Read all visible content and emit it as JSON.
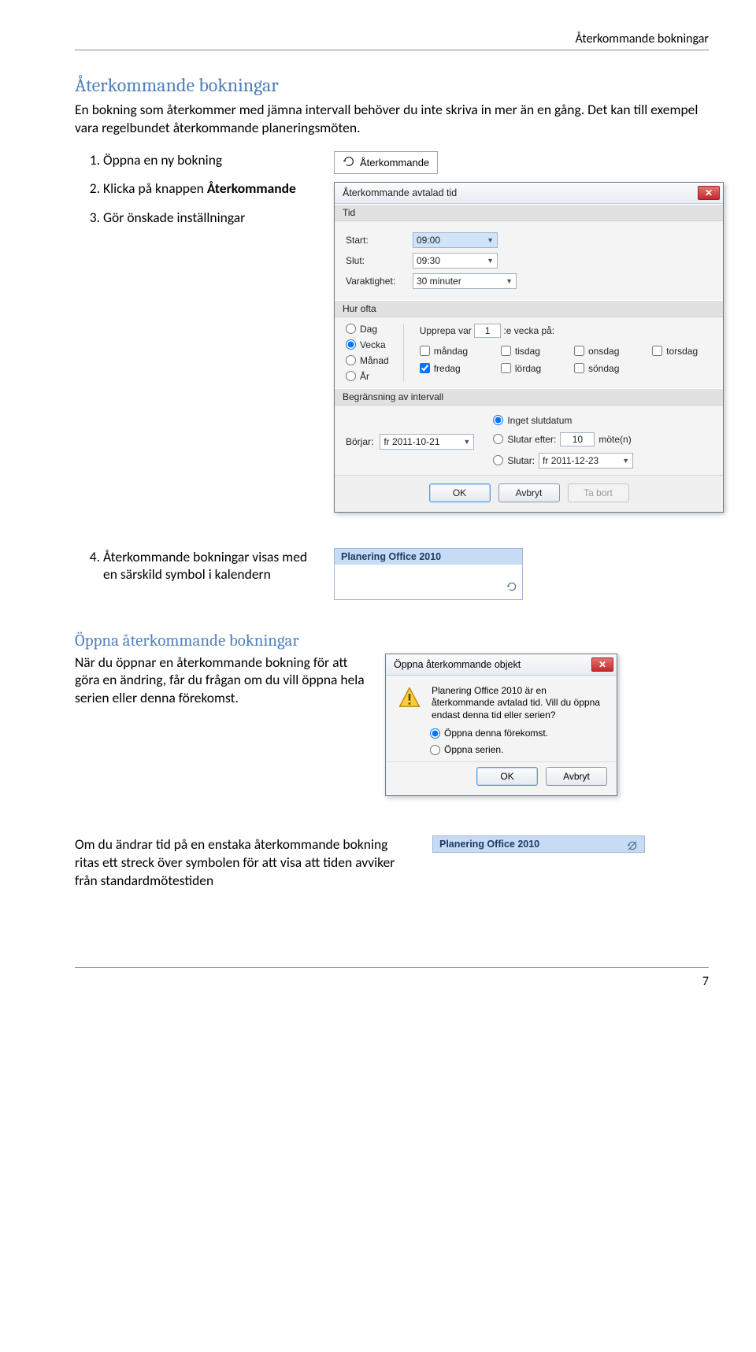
{
  "header": {
    "text": "Återkommande bokningar"
  },
  "title": "Återkommande bokningar",
  "intro": "En bokning som återkommer med jämna intervall behöver du inte skriva in mer än en gång. Det kan till exempel vara regelbundet återkommande planeringsmöten.",
  "steps": {
    "s1": "Öppna en ny bokning",
    "s2a": "Klicka på knappen ",
    "s2b": "Återkommande",
    "s3": "Gör önskade inställningar",
    "s4": "Återkommande bokningar visas med en särskild symbol i kalendern"
  },
  "recurButton": {
    "label": "Återkommande"
  },
  "dialog": {
    "title": "Återkommande avtalad tid",
    "groupTime": "Tid",
    "start": "Start:",
    "startVal": "09:00",
    "end": "Slut:",
    "endVal": "09:30",
    "duration": "Varaktighet:",
    "durationVal": "30 minuter",
    "groupPattern": "Hur ofta",
    "optDay": "Dag",
    "optWeek": "Vecka",
    "optMonth": "Månad",
    "optYear": "År",
    "repeatEvery1": "Upprepa var",
    "repeatNum": "1",
    "repeatEvery2": ":e vecka på:",
    "dMon": "måndag",
    "dTue": "tisdag",
    "dWed": "onsdag",
    "dThu": "torsdag",
    "dFri": "fredag",
    "dSat": "lördag",
    "dSun": "söndag",
    "groupRange": "Begränsning av intervall",
    "rangeStart": "Börjar:",
    "rangeStartVal": "fr 2011-10-21",
    "noEnd": "Inget slutdatum",
    "endAfter": "Slutar efter:",
    "endAfterNum": "10",
    "endAfterUnit": "möte(n)",
    "endBy": "Slutar:",
    "endByVal": "fr 2011-12-23",
    "btnOk": "OK",
    "btnCancel": "Avbryt",
    "btnDelete": "Ta bort"
  },
  "calendarEvent": {
    "title": "Planering Office 2010"
  },
  "section2": {
    "title": "Öppna återkommande bokningar",
    "body": "När du öppnar en återkommande bokning för att göra en ändring, får du frågan om du vill öppna hela serien eller denna förekomst."
  },
  "smallDialog": {
    "title": "Öppna återkommande objekt",
    "msg": "Planering Office 2010 är en återkommande avtalad tid. Vill du öppna endast denna tid eller serien?",
    "opt1": "Öppna denna förekomst.",
    "opt2": "Öppna serien.",
    "btnOk": "OK",
    "btnCancel": "Avbryt"
  },
  "section3": {
    "body": "Om du ändrar tid på en enstaka återkommande bokning ritas ett streck över symbolen för att visa att tiden avviker från standardmötestiden"
  },
  "pageNumber": "7"
}
